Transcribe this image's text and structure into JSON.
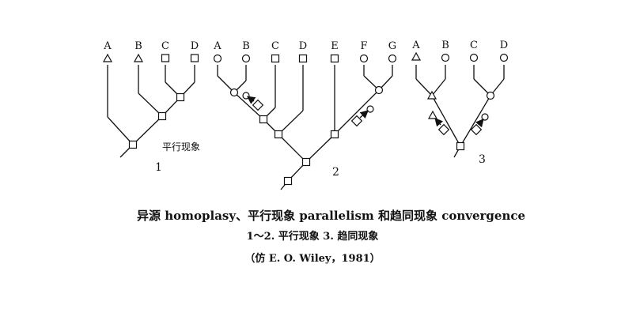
{
  "tree1": {
    "tips": [
      "A",
      "B",
      "C",
      "D"
    ],
    "label": "1",
    "annotation": "平行现象"
  },
  "tree2": {
    "tips": [
      "A",
      "B",
      "C",
      "D",
      "E",
      "F",
      "G"
    ],
    "label": "2"
  },
  "tree3": {
    "tips": [
      "A",
      "B",
      "C",
      "D"
    ],
    "label": "3"
  },
  "caption": {
    "line1": "异源 homoplasy、平行现象 parallelism 和趋同现象 convergence",
    "line2": "1～2. 平行现象    3. 趋同现象",
    "line3": "（仿 E. O. Wiley，1981）"
  }
}
